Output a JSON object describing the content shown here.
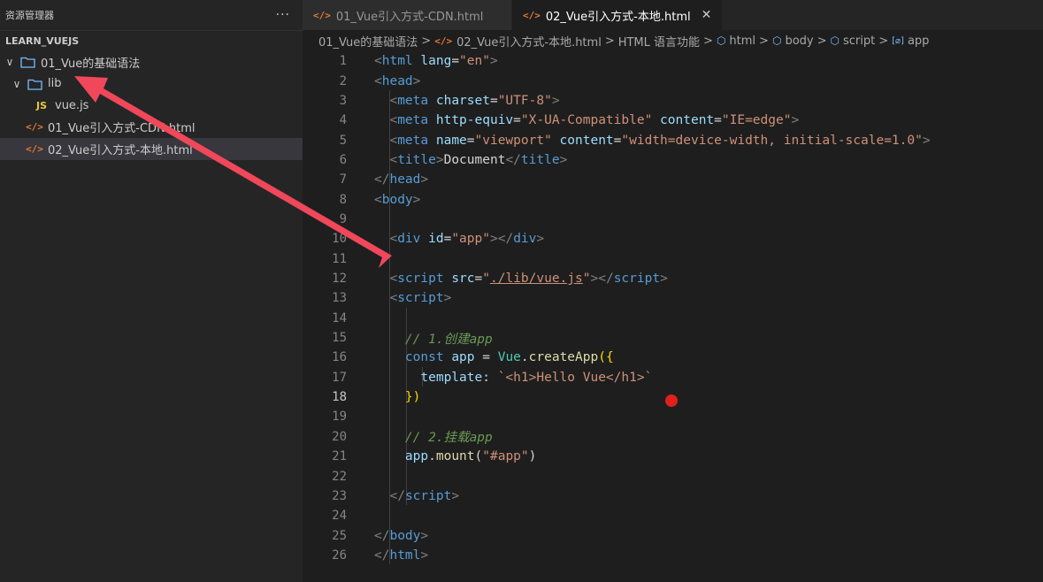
{
  "sidebar": {
    "title": "资源管理器",
    "more": "···",
    "section": "LEARN_VUEJS",
    "tree": [
      {
        "label": "01_Vue的基础语法",
        "chevron": "∨",
        "icon": "folder-icon"
      },
      {
        "label": "lib",
        "chevron": "∨",
        "icon": "folder-icon"
      },
      {
        "label": "vue.js",
        "icon_text": "JS"
      },
      {
        "label": "01_Vue引入方式-CDN.html",
        "icon_text": "</>"
      },
      {
        "label": "02_Vue引入方式-本地.html",
        "icon_text": "</>"
      }
    ]
  },
  "tabs": [
    {
      "label": "01_Vue引入方式-CDN.html",
      "icon_text": "</>"
    },
    {
      "label": "02_Vue引入方式-本地.html",
      "icon_text": "</>",
      "close": "✕"
    }
  ],
  "breadcrumb": {
    "folder": "01_Vue的基础语法",
    "file": "02_Vue引入方式-本地.html",
    "section": "HTML 语言功能",
    "html": "html",
    "body": "body",
    "script": "script",
    "app": "app",
    "sep": ">",
    "file_icon": "</>",
    "cube_icon": "⬡",
    "app_icon": "[⌀]"
  },
  "editor": {
    "current_line": 18,
    "lines": [
      {
        "n": "1",
        "tokens": [
          [
            "br",
            "<"
          ],
          [
            "tag",
            "html "
          ],
          [
            "attr",
            "lang"
          ],
          [
            "txt",
            "="
          ],
          [
            "str",
            "\"en\""
          ],
          [
            "br",
            ">"
          ]
        ]
      },
      {
        "n": "2",
        "tokens": [
          [
            "br",
            "<"
          ],
          [
            "tag",
            "head"
          ],
          [
            "br",
            ">"
          ]
        ]
      },
      {
        "n": "3",
        "tokens": [
          [
            "txt",
            "  "
          ],
          [
            "br",
            "<"
          ],
          [
            "tag",
            "meta "
          ],
          [
            "attr",
            "charset"
          ],
          [
            "txt",
            "="
          ],
          [
            "str",
            "\"UTF-8\""
          ],
          [
            "br",
            ">"
          ]
        ]
      },
      {
        "n": "4",
        "tokens": [
          [
            "txt",
            "  "
          ],
          [
            "br",
            "<"
          ],
          [
            "tag",
            "meta "
          ],
          [
            "attr",
            "http-equiv"
          ],
          [
            "txt",
            "="
          ],
          [
            "str",
            "\"X-UA-Compatible\" "
          ],
          [
            "attr",
            "content"
          ],
          [
            "txt",
            "="
          ],
          [
            "str",
            "\"IE=edge\""
          ],
          [
            "br",
            ">"
          ]
        ]
      },
      {
        "n": "5",
        "tokens": [
          [
            "txt",
            "  "
          ],
          [
            "br",
            "<"
          ],
          [
            "tag",
            "meta "
          ],
          [
            "attr",
            "name"
          ],
          [
            "txt",
            "="
          ],
          [
            "str",
            "\"viewport\" "
          ],
          [
            "attr",
            "content"
          ],
          [
            "txt",
            "="
          ],
          [
            "str",
            "\"width=device-width, initial-scale=1.0\""
          ],
          [
            "br",
            ">"
          ]
        ]
      },
      {
        "n": "6",
        "tokens": [
          [
            "txt",
            "  "
          ],
          [
            "br",
            "<"
          ],
          [
            "tag",
            "title"
          ],
          [
            "br",
            ">"
          ],
          [
            "txt",
            "Document"
          ],
          [
            "br",
            "</"
          ],
          [
            "tag",
            "title"
          ],
          [
            "br",
            ">"
          ]
        ]
      },
      {
        "n": "7",
        "tokens": [
          [
            "br",
            "</"
          ],
          [
            "tag",
            "head"
          ],
          [
            "br",
            ">"
          ]
        ]
      },
      {
        "n": "8",
        "tokens": [
          [
            "br",
            "<"
          ],
          [
            "tag",
            "body"
          ],
          [
            "br",
            ">"
          ]
        ]
      },
      {
        "n": "9",
        "tokens": []
      },
      {
        "n": "10",
        "tokens": [
          [
            "txt",
            "  "
          ],
          [
            "br",
            "<"
          ],
          [
            "tag",
            "div "
          ],
          [
            "attr",
            "id"
          ],
          [
            "txt",
            "="
          ],
          [
            "str",
            "\"app\""
          ],
          [
            "br",
            "></"
          ],
          [
            "tag",
            "div"
          ],
          [
            "br",
            ">"
          ]
        ]
      },
      {
        "n": "11",
        "tokens": []
      },
      {
        "n": "12",
        "tokens": [
          [
            "txt",
            "  "
          ],
          [
            "br",
            "<"
          ],
          [
            "tag",
            "script "
          ],
          [
            "attr",
            "src"
          ],
          [
            "txt",
            "="
          ],
          [
            "str",
            "\""
          ],
          [
            "strlink",
            "./lib/vue.js"
          ],
          [
            "str",
            "\""
          ],
          [
            "br",
            "></"
          ],
          [
            "tag",
            "script"
          ],
          [
            "br",
            ">"
          ]
        ]
      },
      {
        "n": "13",
        "tokens": [
          [
            "txt",
            "  "
          ],
          [
            "br",
            "<"
          ],
          [
            "tag",
            "script"
          ],
          [
            "br",
            ">"
          ]
        ]
      },
      {
        "n": "14",
        "tokens": []
      },
      {
        "n": "15",
        "tokens": [
          [
            "txt",
            "    "
          ],
          [
            "cmt",
            "// 1.创建app"
          ]
        ]
      },
      {
        "n": "16",
        "tokens": [
          [
            "txt",
            "    "
          ],
          [
            "kw",
            "const "
          ],
          [
            "var",
            "app"
          ],
          [
            "txt",
            " = "
          ],
          [
            "cls",
            "Vue"
          ],
          [
            "txt",
            "."
          ],
          [
            "fn",
            "createApp"
          ],
          [
            "brace",
            "({"
          ]
        ]
      },
      {
        "n": "17",
        "tokens": [
          [
            "txt",
            "      "
          ],
          [
            "var",
            "template"
          ],
          [
            "txt",
            ": "
          ],
          [
            "tpl",
            "`<h1>Hello Vue</h1>`"
          ]
        ]
      },
      {
        "n": "18",
        "tokens": [
          [
            "txt",
            "    "
          ],
          [
            "brace",
            "})"
          ]
        ]
      },
      {
        "n": "19",
        "tokens": []
      },
      {
        "n": "20",
        "tokens": [
          [
            "txt",
            "    "
          ],
          [
            "cmt",
            "// 2.挂载app"
          ]
        ]
      },
      {
        "n": "21",
        "tokens": [
          [
            "txt",
            "    "
          ],
          [
            "var",
            "app"
          ],
          [
            "txt",
            "."
          ],
          [
            "fn",
            "mount"
          ],
          [
            "txt",
            "("
          ],
          [
            "str",
            "\"#app\""
          ],
          [
            "txt",
            ")"
          ]
        ]
      },
      {
        "n": "22",
        "tokens": []
      },
      {
        "n": "23",
        "tokens": [
          [
            "txt",
            "  "
          ],
          [
            "br",
            "</"
          ],
          [
            "tag",
            "script"
          ],
          [
            "br",
            ">"
          ]
        ]
      },
      {
        "n": "24",
        "tokens": []
      },
      {
        "n": "25",
        "tokens": [
          [
            "br",
            "</"
          ],
          [
            "tag",
            "body"
          ],
          [
            "br",
            ">"
          ]
        ]
      },
      {
        "n": "26",
        "tokens": [
          [
            "br",
            "</"
          ],
          [
            "tag",
            "html"
          ],
          [
            "br",
            ">"
          ]
        ]
      }
    ]
  },
  "colors": {
    "annotation_arrow": "#f0485a",
    "marker_dot": "#e0201c"
  }
}
